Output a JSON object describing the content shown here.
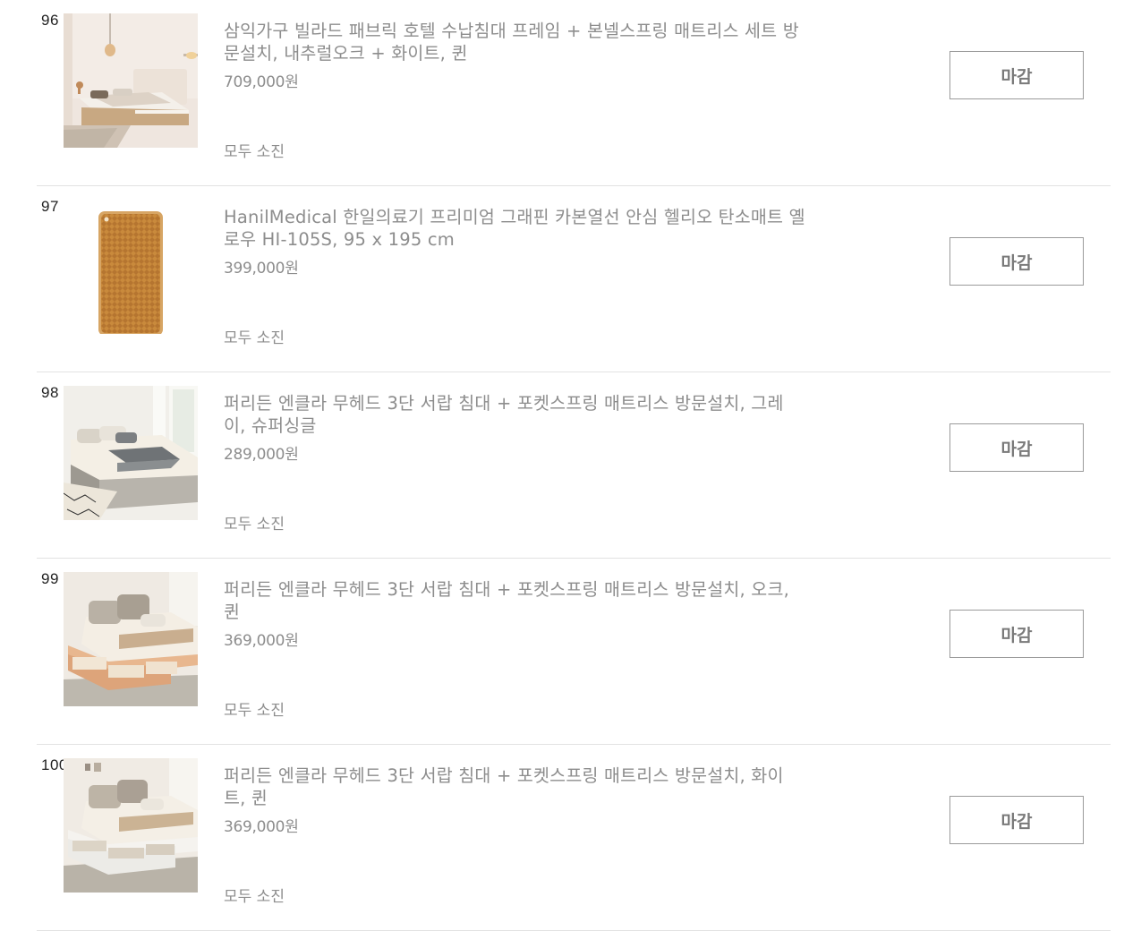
{
  "items": [
    {
      "rank": "96",
      "image_icon": "bed-photo-beige-room",
      "title": "삼익가구 빌라드 패브릭 호텔 수납침대 프레임 + 본넬스프링 매트리스 세트 방문설치, 내추럴오크 + 화이트, 퀸",
      "price": "709,000원",
      "status": "모두 소진",
      "button_label": "마감"
    },
    {
      "rank": "97",
      "image_icon": "heating-mat-photo",
      "title": "HanilMedical 한일의료기 프리미엄 그래핀 카본열선 안심 헬리오 탄소매트 옐로우 HI-105S, 95 x 195 cm",
      "price": "399,000원",
      "status": "모두 소진",
      "button_label": "마감"
    },
    {
      "rank": "98",
      "image_icon": "gray-drawer-bed-photo",
      "title": "퍼리든 엔클라 무헤드 3단 서랍 침대 + 포켓스프링 매트리스 방문설치, 그레이, 슈퍼싱글",
      "price": "289,000원",
      "status": "모두 소진",
      "button_label": "마감"
    },
    {
      "rank": "99",
      "image_icon": "oak-drawer-bed-photo",
      "title": "퍼리든 엔클라 무헤드 3단 서랍 침대 + 포켓스프링 매트리스 방문설치, 오크, 퀸",
      "price": "369,000원",
      "status": "모두 소진",
      "button_label": "마감"
    },
    {
      "rank": "100",
      "image_icon": "white-drawer-bed-photo",
      "title": "퍼리든 엔클라 무헤드 3단 서랍 침대 + 포켓스프링 매트리스 방문설치, 화이트, 퀸",
      "price": "369,000원",
      "status": "모두 소진",
      "button_label": "마감"
    }
  ],
  "colors": {
    "text_muted": "#8d8d8d",
    "rank_text": "#222222",
    "divider": "#e2e2e2",
    "button_border": "#9a9a9a",
    "button_text": "#7a7a7a"
  }
}
